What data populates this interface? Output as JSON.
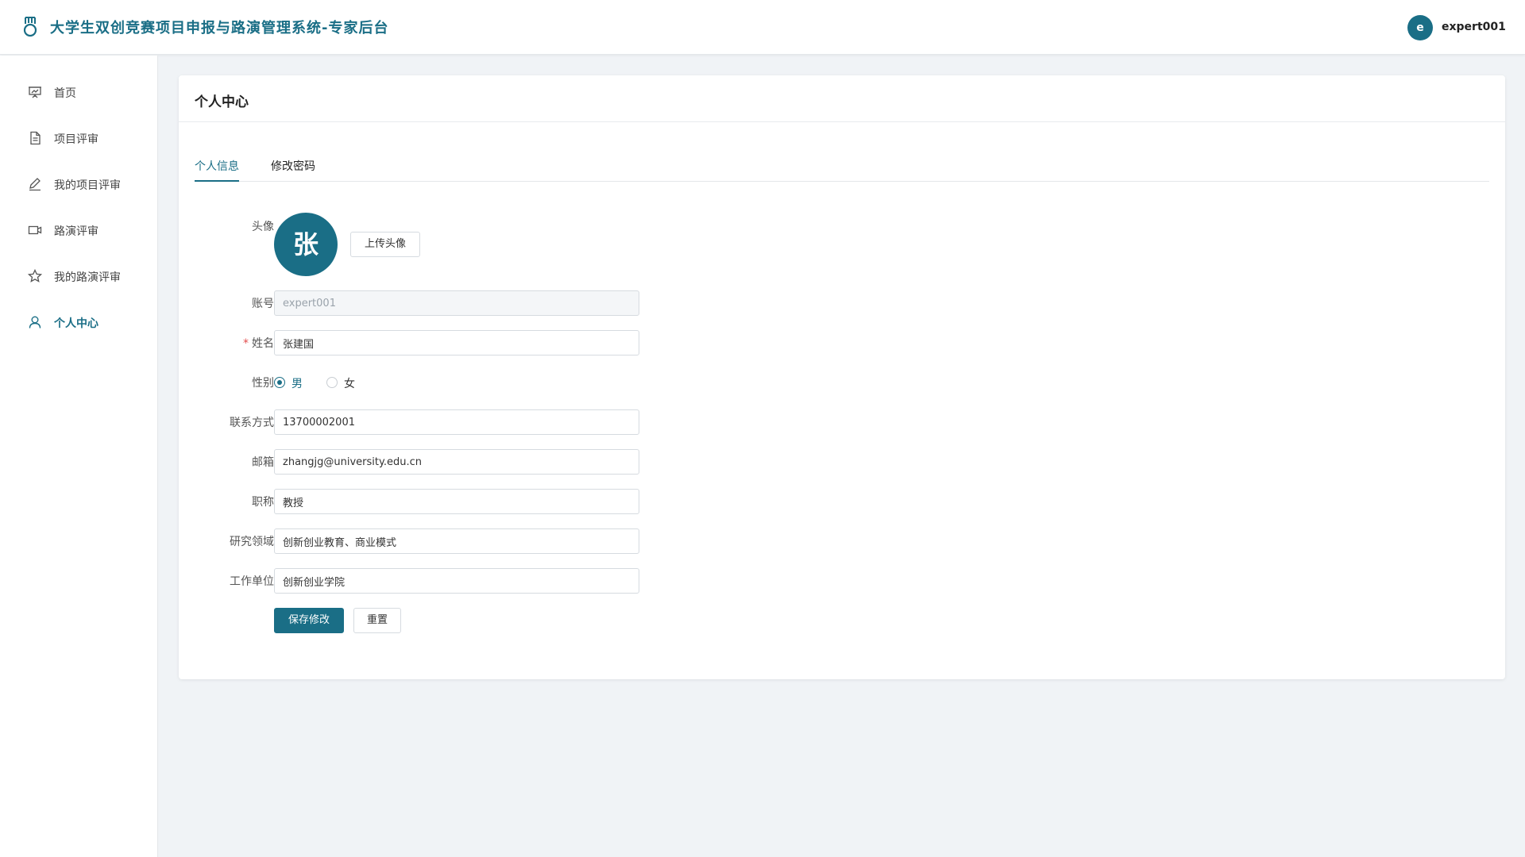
{
  "header": {
    "title": "大学生双创竞赛项目申报与路演管理系统-专家后台",
    "avatar_letter": "e",
    "username": "expert001"
  },
  "sidebar": {
    "items": [
      {
        "label": "首页",
        "icon": "presentation-chart-icon",
        "active": false
      },
      {
        "label": "项目评审",
        "icon": "document-icon",
        "active": false
      },
      {
        "label": "我的项目评审",
        "icon": "pen-icon",
        "active": false
      },
      {
        "label": "路演评审",
        "icon": "video-camera-icon",
        "active": false
      },
      {
        "label": "我的路演评审",
        "icon": "star-icon",
        "active": false
      },
      {
        "label": "个人中心",
        "icon": "user-icon",
        "active": true
      }
    ]
  },
  "main": {
    "title": "个人中心",
    "tabs": [
      {
        "label": "个人信息",
        "active": true
      },
      {
        "label": "修改密码",
        "active": false
      }
    ],
    "form": {
      "avatar_label": "头像",
      "avatar_char": "张",
      "upload_label": "上传头像",
      "account_label": "账号",
      "account_value": "expert001",
      "name_required_mark": "*",
      "name_label": "姓名",
      "name_value": "张建国",
      "gender_label": "性别",
      "gender_options": [
        "男",
        "女"
      ],
      "gender_selected": "男",
      "phone_label": "联系方式",
      "phone_value": "13700002001",
      "email_label": "邮箱",
      "email_value": "zhangjg@university.edu.cn",
      "title_label": "职称",
      "title_value": "教授",
      "research_label": "研究领域",
      "research_value": "创新创业教育、商业模式",
      "unit_label": "工作单位",
      "unit_value": "创新创业学院",
      "save_label": "保存修改",
      "reset_label": "重置"
    }
  },
  "colors": {
    "primary": "#1a6e86",
    "required": "#e34d4d",
    "background": "#f0f3f6"
  }
}
